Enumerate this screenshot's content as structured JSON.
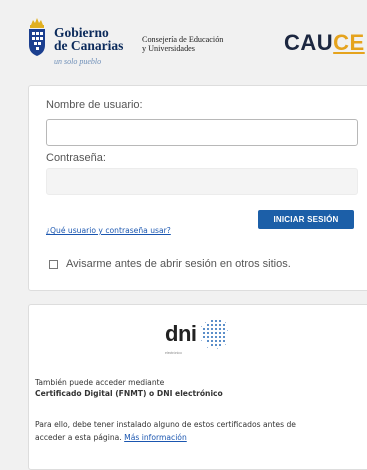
{
  "header": {
    "logo_line1": "Gobierno",
    "logo_line2": "de Canarias",
    "logo_tagline": "un solo pueblo",
    "consejeria_line1": "Consejería de Educación",
    "consejeria_line2": "y Universidades",
    "brand_main": "CAU",
    "brand_accent": "CE"
  },
  "login": {
    "username_label": "Nombre de usuario:",
    "username_value": "",
    "password_label": "Contraseña:",
    "password_value": "",
    "help_link": "¿Qué usuario y contraseña usar?",
    "submit_label": "INICIAR SESIÓN",
    "remember_label": "Avisarme antes de abrir sesión en otros sitios.",
    "remember_checked": false
  },
  "dni": {
    "logo_text": "dni",
    "logo_subtext": "electrónico",
    "line1": "También puede acceder mediante",
    "line2": "Certificado Digital (FNMT) o DNI electrónico",
    "line3": "Para ello, debe tener instalado alguno de estos certificados antes de",
    "line4_text": "acceder a esta página.",
    "more_info_link": "Más información"
  },
  "colors": {
    "brand_dark": "#1c2740",
    "brand_accent": "#e5a31d",
    "button_bg": "#1c5fa8",
    "link": "#1a56b0"
  }
}
